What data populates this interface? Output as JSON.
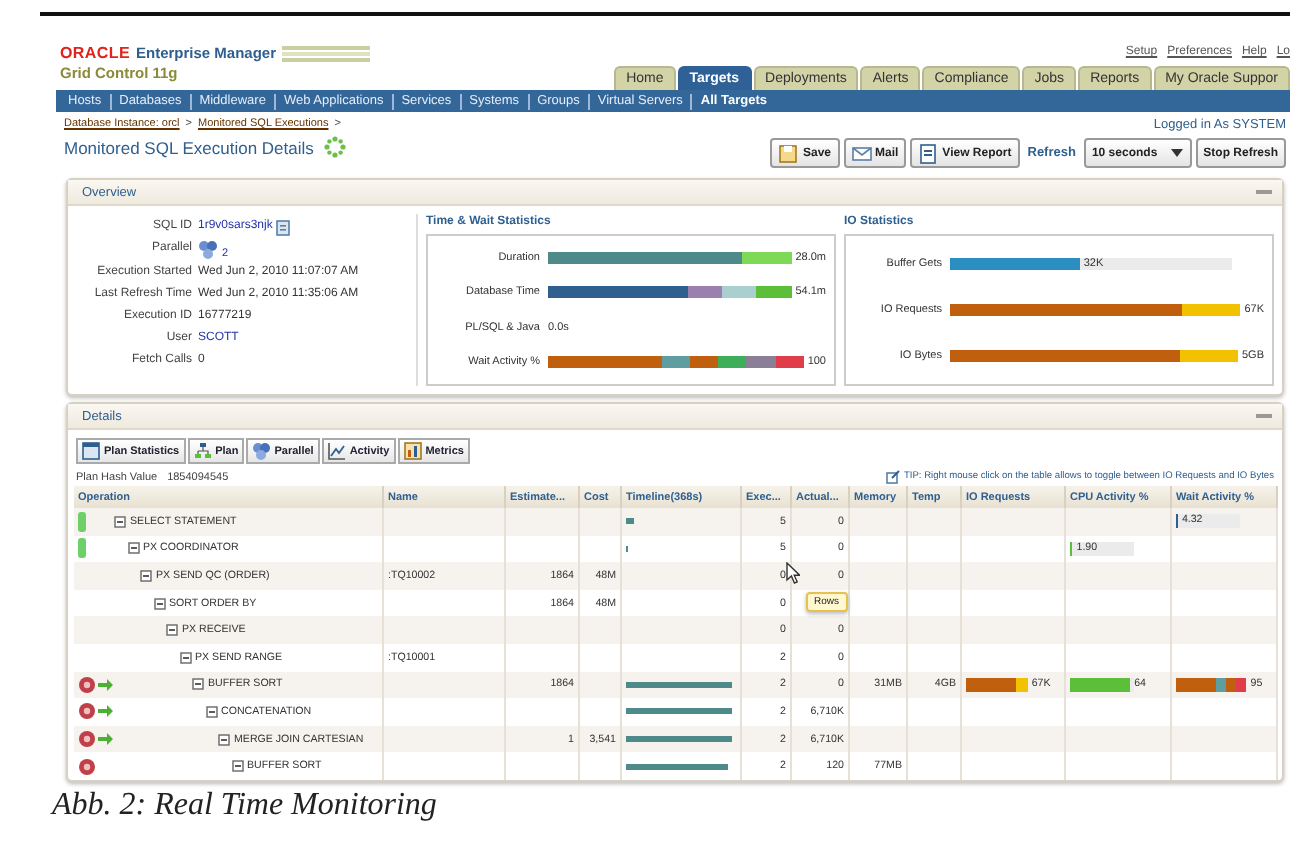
{
  "header": {
    "brand": "ORACLE",
    "product": "Enterprise Manager",
    "edition": "Grid Control 11g",
    "global_links": [
      "Setup",
      "Preferences",
      "Help",
      "Lo"
    ],
    "tabs": [
      {
        "label": "Home",
        "selected": false
      },
      {
        "label": "Targets",
        "selected": true
      },
      {
        "label": "Deployments",
        "selected": false
      },
      {
        "label": "Alerts",
        "selected": false
      },
      {
        "label": "Compliance",
        "selected": false
      },
      {
        "label": "Jobs",
        "selected": false
      },
      {
        "label": "Reports",
        "selected": false
      },
      {
        "label": "My Oracle Suppor",
        "selected": false
      }
    ],
    "subtabs": [
      {
        "label": "Hosts",
        "selected": false
      },
      {
        "label": "Databases",
        "selected": false
      },
      {
        "label": "Middleware",
        "selected": false
      },
      {
        "label": "Web Applications",
        "selected": false
      },
      {
        "label": "Services",
        "selected": false
      },
      {
        "label": "Systems",
        "selected": false
      },
      {
        "label": "Groups",
        "selected": false
      },
      {
        "label": "Virtual Servers",
        "selected": false
      },
      {
        "label": "All Targets",
        "selected": true
      }
    ]
  },
  "breadcrumb": [
    {
      "label": "Database Instance: orcl",
      "separator": ">"
    },
    {
      "label": "Monitored SQL Executions",
      "separator": ">"
    }
  ],
  "page": {
    "title": "Monitored SQL Execution Details",
    "logged_in": "Logged in As SYSTEM"
  },
  "toolbar": {
    "buttons": [
      {
        "label": "Save",
        "kind": "save"
      },
      {
        "label": "Mail",
        "kind": "mail"
      },
      {
        "label": "View Report",
        "kind": "report"
      }
    ],
    "refresh_label": "Refresh",
    "refresh_select": "10 seconds",
    "stop_button": "Stop Refresh"
  },
  "overview": {
    "title": "Overview",
    "info": [
      {
        "label": "SQL ID",
        "value": "1r9v0sars3njk",
        "kind": "link"
      },
      {
        "label": "Parallel",
        "value": "2",
        "kind": "parallel"
      },
      {
        "label": "Execution Started",
        "value": "Wed Jun 2, 2010 11:07:07 AM",
        "kind": "text"
      },
      {
        "label": "Last Refresh Time",
        "value": "Wed Jun 2, 2010 11:35:06 AM",
        "kind": "text"
      },
      {
        "label": "Execution ID",
        "value": "16777219",
        "kind": "text"
      },
      {
        "label": "User",
        "value": "SCOTT",
        "kind": "user"
      },
      {
        "label": "Fetch Calls",
        "value": "0",
        "kind": "text"
      }
    ],
    "time_wait": {
      "title": "Time & Wait Statistics",
      "rows": [
        {
          "label": "Duration",
          "reading": "28.0m",
          "segments": [
            {
              "color": "#4f8a8b"
            },
            {
              "color": "#7ed957"
            }
          ]
        },
        {
          "label": "Database Time",
          "reading": "54.1m",
          "segments": [
            {
              "color": "#2e5f8f"
            },
            {
              "color": "#9a7fb0"
            },
            {
              "color": "#a9cfcf"
            },
            {
              "color": "#5cbf3a"
            }
          ]
        },
        {
          "label": "PL/SQL & Java",
          "reading": "0.0s"
        },
        {
          "label": "Wait Activity %",
          "reading": "100",
          "segments": [
            {
              "color": "#c0600e"
            },
            {
              "color": "#5f9ea0"
            },
            {
              "color": "#c0600e"
            },
            {
              "color": "#3fae5a"
            },
            {
              "color": "#8a7f96"
            },
            {
              "color": "#e03c4a"
            }
          ]
        }
      ]
    },
    "io": {
      "title": "IO Statistics",
      "rows": [
        {
          "label": "Buffer Gets",
          "reading": "32K",
          "level": 0.46,
          "segments": [
            {
              "color": "#2a8fc0"
            }
          ]
        },
        {
          "label": "IO Requests",
          "reading": "67K",
          "segments": [
            {
              "color": "#c0600e"
            },
            {
              "color": "#f2c200"
            }
          ]
        },
        {
          "label": "IO Bytes",
          "reading": "5GB",
          "segments": [
            {
              "color": "#c0600e"
            },
            {
              "color": "#f2c200"
            }
          ]
        }
      ]
    }
  },
  "details": {
    "title": "Details",
    "buttons": [
      {
        "label": "Plan Statistics",
        "kind": "table"
      },
      {
        "label": "Plan",
        "kind": "tree"
      },
      {
        "label": "Parallel",
        "kind": "parallel"
      },
      {
        "label": "Activity",
        "kind": "chart"
      },
      {
        "label": "Metrics",
        "kind": "metrics"
      }
    ],
    "plan_hash_label": "Plan Hash Value",
    "plan_hash": "1854094545",
    "tip": "TIP: Right mouse click on the table allows to toggle between IO Requests and IO Bytes",
    "columns": [
      "Operation",
      "Name",
      "Estimate...",
      "Cost",
      "Timeline(368s)",
      "Exec...",
      "Actual...",
      "Memory",
      "Temp",
      "IO Requests",
      "CPU Activity %",
      "Wait Activity %"
    ],
    "tooltip": "Rows",
    "plan": [
      {
        "operation": "SELECT STATEMENT",
        "expanded": true,
        "kind": "active",
        "exec": "5",
        "actual": "0",
        "timeline": {
          "level": 0.07
        },
        "wait": {
          "reading": "4.32",
          "level": 0.03,
          "segments": [
            {
              "color": "#2e5f8f"
            }
          ]
        },
        "children": [
          {
            "operation": "PX COORDINATOR",
            "expanded": true,
            "kind": "active",
            "exec": "5",
            "actual": "0",
            "timeline": {
              "level": 0.02
            },
            "cpu": {
              "reading": "1.90",
              "level": 0.04,
              "segments": [
                {
                  "color": "#5cbf3a"
                }
              ]
            },
            "children": [
              {
                "operation": "PX SEND QC (ORDER)",
                "expanded": true,
                "name": ":TQ10002",
                "estimate": "1864",
                "cost": "48M",
                "exec": "0",
                "actual": "0",
                "children": [
                  {
                    "operation": "SORT ORDER BY",
                    "expanded": true,
                    "estimate": "1864",
                    "cost": "48M",
                    "exec": "0",
                    "children": [
                      {
                        "operation": "PX RECEIVE",
                        "expanded": true,
                        "exec": "0",
                        "actual": "0",
                        "children": [
                          {
                            "operation": "PX SEND RANGE",
                            "expanded": true,
                            "name": ":TQ10001",
                            "exec": "2",
                            "actual": "0",
                            "children": [
                              {
                                "operation": "BUFFER SORT",
                                "expanded": true,
                                "kind": "running",
                                "estimate": "1864",
                                "timeline": {
                                  "level": 0.97
                                },
                                "exec": "2",
                                "actual": "0",
                                "memory": "31MB",
                                "temp": "4GB",
                                "io": {
                                  "reading": "67K",
                                  "segments": [
                                    {
                                      "color": "#c0600e"
                                    },
                                    {
                                      "color": "#f2c200"
                                    }
                                  ]
                                },
                                "cpu": {
                                  "reading": "64",
                                  "level": 0.95,
                                  "segments": [
                                    {
                                      "color": "#5cbf3a"
                                    }
                                  ]
                                },
                                "wait": {
                                  "reading": "95",
                                  "segments": [
                                    {
                                      "color": "#c0600e"
                                    },
                                    {
                                      "color": "#5f9ea0"
                                    },
                                    {
                                      "color": "#c0600e"
                                    },
                                    {
                                      "color": "#e03c4a"
                                    }
                                  ]
                                },
                                "children": [
                                  {
                                    "operation": "CONCATENATION",
                                    "expanded": true,
                                    "kind": "running",
                                    "timeline": {
                                      "level": 0.97
                                    },
                                    "exec": "2",
                                    "actual": "6,710K",
                                    "children": [
                                      {
                                        "operation": "MERGE JOIN CARTESIAN",
                                        "expanded": true,
                                        "kind": "running",
                                        "estimate": "1",
                                        "cost": "3,541",
                                        "timeline": {
                                          "level": 0.97
                                        },
                                        "exec": "2",
                                        "actual": "6,710K",
                                        "children": [
                                          {
                                            "operation": "BUFFER SORT",
                                            "expanded": true,
                                            "kind": "done",
                                            "timeline": {
                                              "level": 0.93
                                            },
                                            "exec": "2",
                                            "actual": "120",
                                            "memory": "77MB"
                                          }
                                        ]
                                      }
                                    ]
                                  }
                                ]
                              }
                            ]
                          }
                        ]
                      }
                    ]
                  }
                ]
              }
            ]
          }
        ]
      }
    ]
  },
  "caption": "Abb. 2: Real Time Monitoring"
}
